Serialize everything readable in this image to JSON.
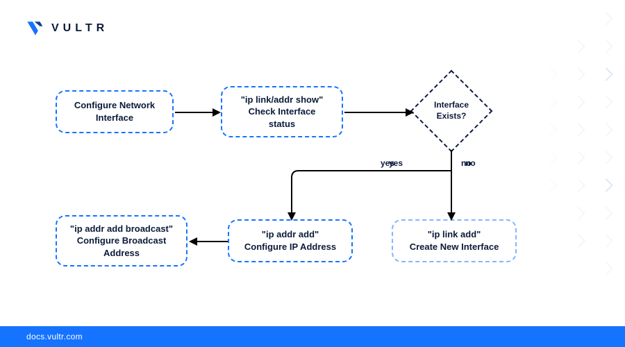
{
  "brand": {
    "name": "VULTR",
    "footer_host": "docs.vultr.com",
    "accent": "#1573ff",
    "logo_alt": "vultr-logo"
  },
  "nodes": {
    "n1": {
      "line1": "Configure Network",
      "line2": "Interface"
    },
    "n2": {
      "line1": "\"ip link/addr show\"",
      "line2": "Check Interface",
      "line3": "status"
    },
    "d1": {
      "line1": "Interface",
      "line2": "Exists?"
    },
    "n3": {
      "line1": "\"ip link add\"",
      "line2": "Create New Interface"
    },
    "n4": {
      "line1": "\"ip addr add\"",
      "line2": "Configure IP Address"
    },
    "n5": {
      "line1": "\"ip addr add broadcast\"",
      "line2": "Configure Broadcast",
      "line3": "Address"
    }
  },
  "edges": {
    "yes": "yes",
    "no": "no"
  }
}
